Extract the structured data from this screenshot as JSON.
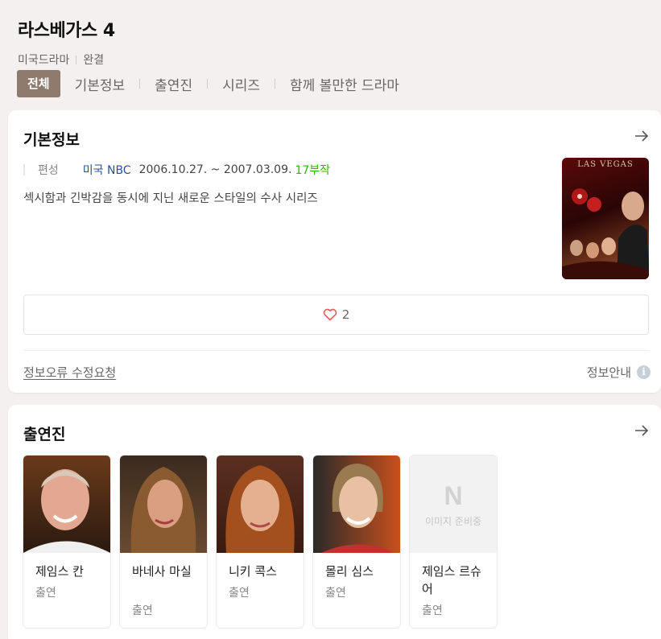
{
  "header": {
    "title": "라스베가스 4",
    "genre": "미국드라마",
    "status": "완결"
  },
  "tabs": [
    {
      "label": "전체",
      "active": true
    },
    {
      "label": "기본정보"
    },
    {
      "label": "출연진"
    },
    {
      "label": "시리즈"
    },
    {
      "label": "함께 볼만한 드라마"
    }
  ],
  "basic": {
    "title": "기본정보",
    "info_key": "편성",
    "network": "미국 NBC",
    "dates": "2006.10.27. ~ 2007.03.09.",
    "episodes": "17부작",
    "description": "섹시함과 긴박감을 동시에 지닌 새로운 스타일의 수사 시리즈",
    "poster_text": "LAS VEGAS",
    "like_count": "2",
    "fix_request": "정보오류 수정요청",
    "info_guide": "정보안내",
    "info_icon": "i"
  },
  "cast": {
    "title": "출연진",
    "members": [
      {
        "name": "제임스 칸",
        "role": "출연",
        "photo": "bald-man-portrait"
      },
      {
        "name": "바네사 마실",
        "role": "출연",
        "photo": "dark-hair-woman-portrait"
      },
      {
        "name": "니키 콕스",
        "role": "출연",
        "photo": "auburn-hair-woman-portrait"
      },
      {
        "name": "몰리 심스",
        "role": "출연",
        "photo": "blonde-woman-portrait"
      },
      {
        "name": "제임스 르슈어",
        "role": "출연",
        "photo": "no-image"
      }
    ],
    "no_image_logo": "N",
    "no_image_text": "이미지 준비중"
  },
  "colors": {
    "active_tab": "#8f7a6e",
    "network_link": "#2a4f9a",
    "episodes_green": "#2db400",
    "heart": "#e35a5a"
  }
}
